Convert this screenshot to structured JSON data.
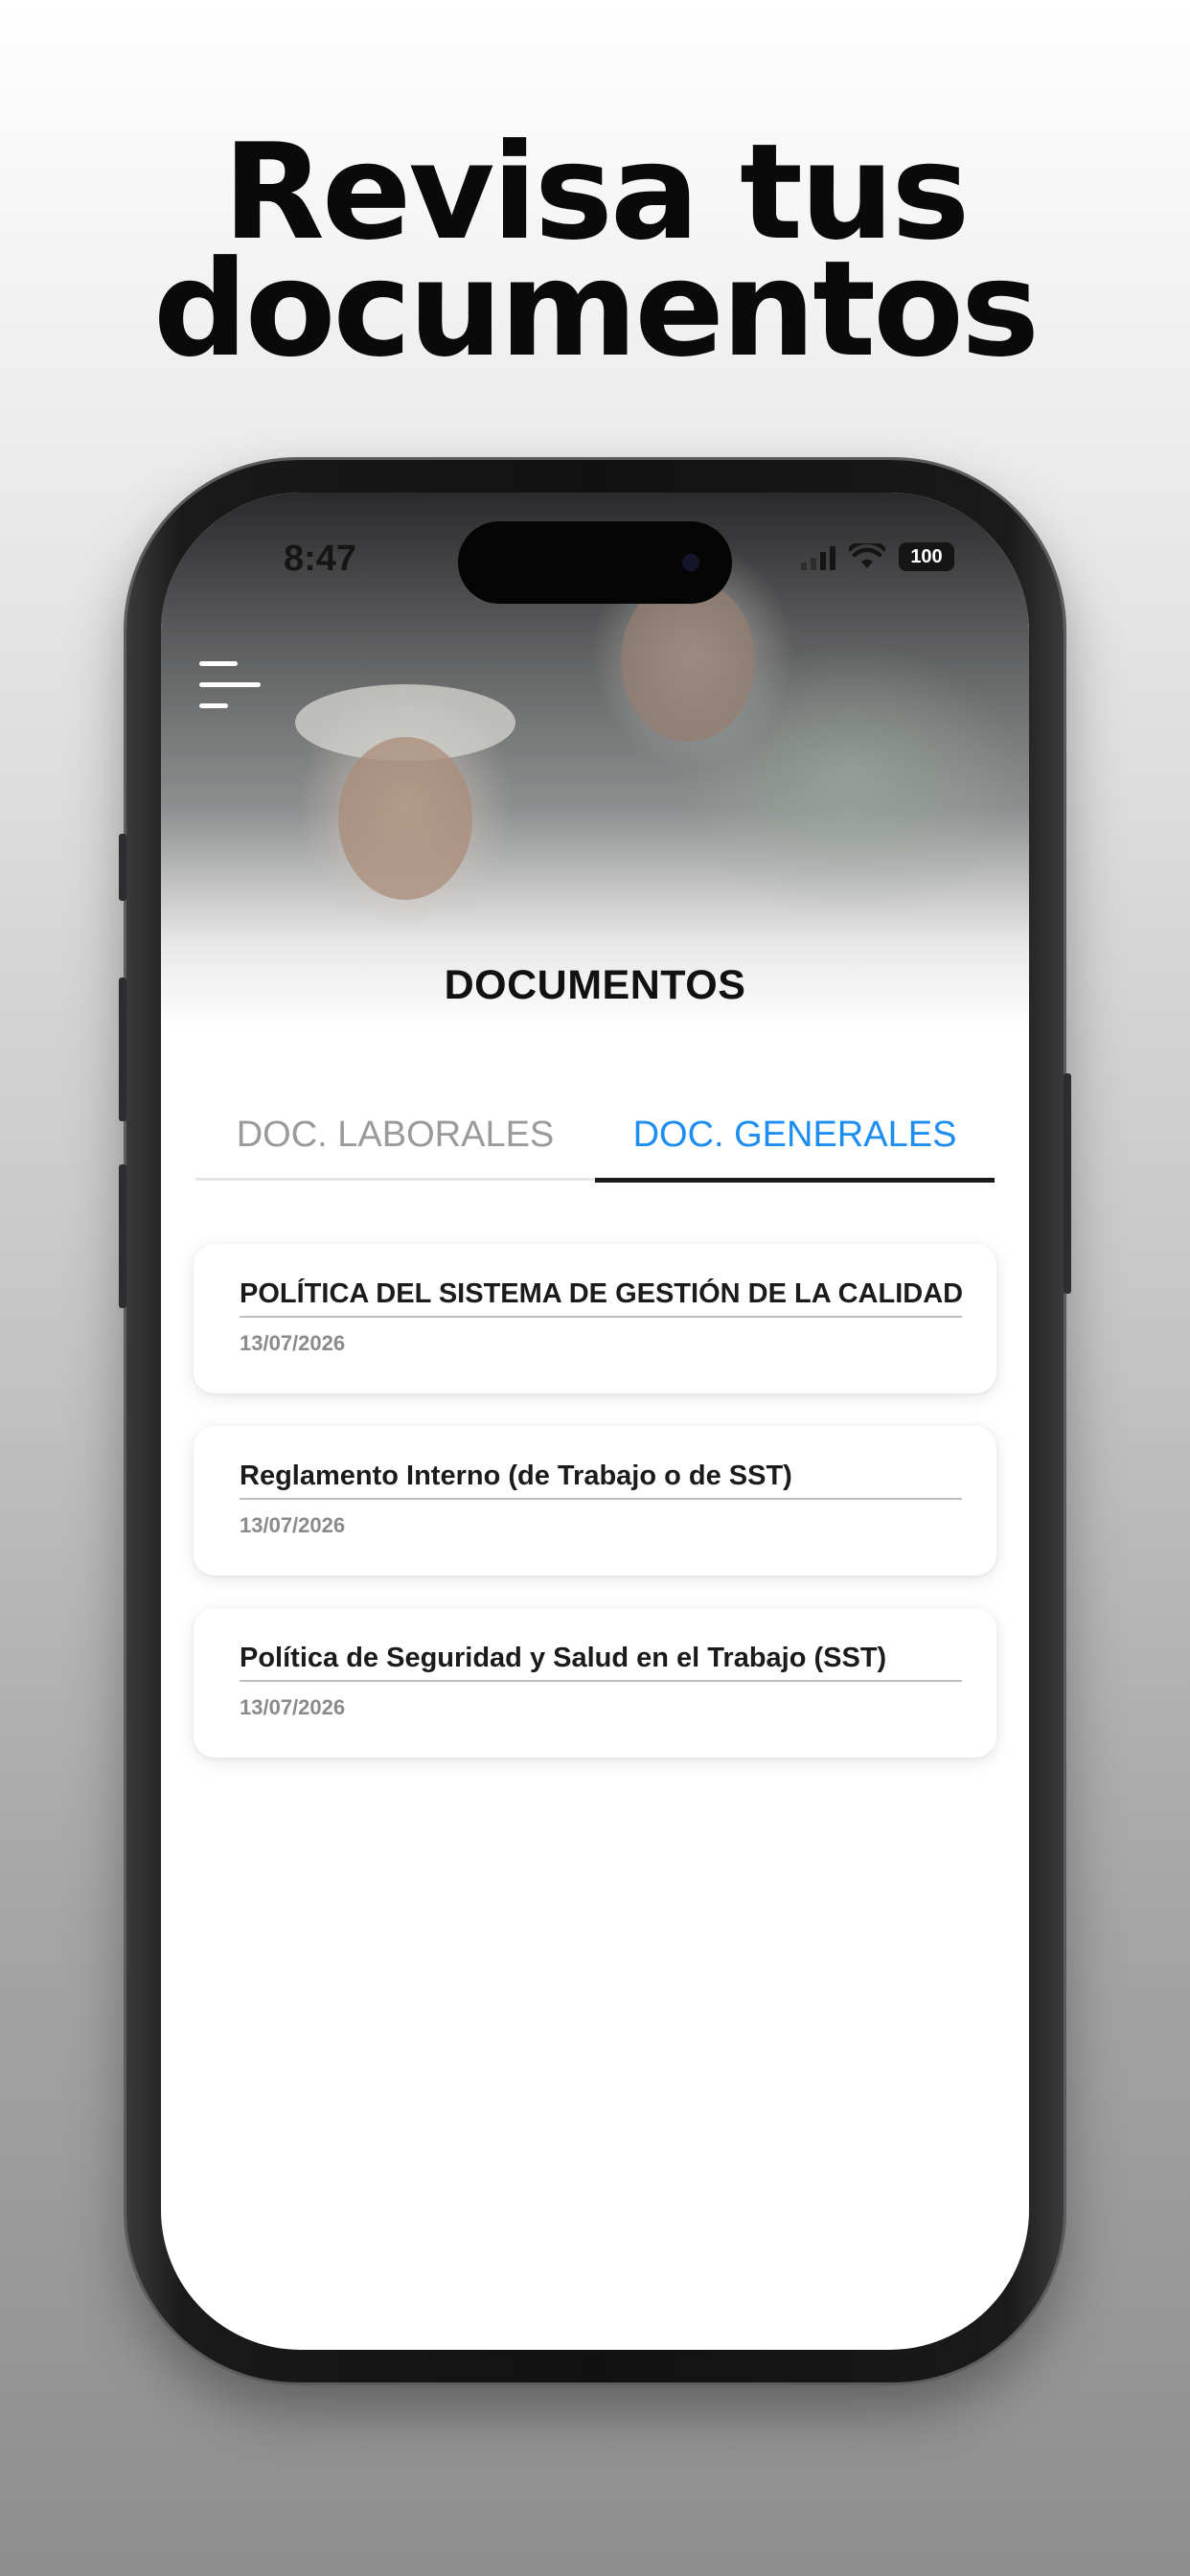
{
  "headline": {
    "line1": "Revisa tus",
    "line2": "documentos"
  },
  "status_bar": {
    "time": "8:47",
    "battery": "100"
  },
  "page": {
    "title": "DOCUMENTOS"
  },
  "tabs": [
    {
      "label": "DOC. LABORALES",
      "active": false
    },
    {
      "label": "DOC. GENERALES",
      "active": true
    }
  ],
  "documents": [
    {
      "title": "POLÍTICA DEL SISTEMA DE GESTIÓN DE LA CALIDAD",
      "date": "13/07/2026"
    },
    {
      "title": "Reglamento Interno (de Trabajo o de SST)",
      "date": "13/07/2026"
    },
    {
      "title": "Política de Seguridad y Salud en el Trabajo (SST)",
      "date": "13/07/2026"
    }
  ],
  "colors": {
    "accent": "#1d8df0",
    "inactive_tab": "#9a9a9a",
    "tab_indicator": "#1a1a1a"
  },
  "icons": {
    "menu": "hamburger-menu-icon",
    "signal": "cellular-signal-icon",
    "wifi": "wifi-icon",
    "battery": "battery-icon"
  }
}
